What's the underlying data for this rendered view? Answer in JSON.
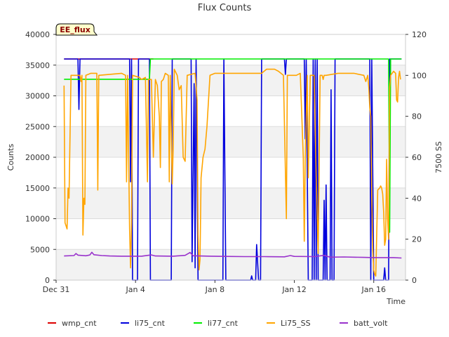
{
  "chart_data": {
    "type": "line",
    "title": "Flux Counts",
    "xlabel": "Time",
    "ylabel": "Counts",
    "ylabel_right": "7500 SS",
    "annotation": "EE_flux",
    "xlim": [
      0,
      17.6
    ],
    "ylim": [
      0,
      40000
    ],
    "ylim_right": [
      0,
      120
    ],
    "x_ticks": [
      {
        "x": 0,
        "label": "Dec 31"
      },
      {
        "x": 4,
        "label": "Jan 4"
      },
      {
        "x": 8,
        "label": "Jan 8"
      },
      {
        "x": 12,
        "label": "Jan 12"
      },
      {
        "x": 16,
        "label": "Jan 16"
      }
    ],
    "y_ticks": [
      0,
      5000,
      10000,
      15000,
      20000,
      25000,
      30000,
      35000,
      40000
    ],
    "y_ticks_right": [
      0,
      20,
      40,
      60,
      80,
      100,
      120
    ],
    "grid": true,
    "legend_position": "bottom",
    "series": [
      {
        "name": "wmp_cnt",
        "color": "#dd0000",
        "axis": "left",
        "points": [
          [
            0.4,
            36000
          ],
          [
            4.9,
            36000
          ]
        ]
      },
      {
        "name": "li75_cnt",
        "color": "#0000dd",
        "axis": "left",
        "points": [
          [
            0.4,
            36000
          ],
          [
            1.1,
            36000
          ],
          [
            1.15,
            27800
          ],
          [
            1.2,
            36000
          ],
          [
            3.7,
            36000
          ],
          [
            3.75,
            16000
          ],
          [
            3.8,
            36000
          ],
          [
            3.85,
            0
          ],
          [
            4.1,
            0
          ],
          [
            4.15,
            36000
          ],
          [
            4.7,
            36000
          ],
          [
            4.75,
            0
          ],
          [
            5.8,
            0
          ],
          [
            5.85,
            36000
          ],
          [
            6.8,
            36000
          ],
          [
            6.85,
            3000
          ],
          [
            6.95,
            32000
          ],
          [
            7.0,
            2000
          ],
          [
            7.05,
            36000
          ],
          [
            7.15,
            0
          ],
          [
            7.3,
            0
          ],
          [
            8.4,
            0
          ],
          [
            8.45,
            36000
          ],
          [
            8.55,
            0
          ],
          [
            9.8,
            0
          ],
          [
            9.85,
            700
          ],
          [
            9.9,
            0
          ],
          [
            10.05,
            0
          ],
          [
            10.1,
            5800
          ],
          [
            10.2,
            0
          ],
          [
            10.3,
            0
          ],
          [
            10.35,
            36000
          ],
          [
            11.5,
            36000
          ],
          [
            11.55,
            33500
          ],
          [
            11.6,
            36000
          ],
          [
            12.5,
            36000
          ],
          [
            12.55,
            23000
          ],
          [
            12.6,
            36000
          ],
          [
            12.7,
            0
          ],
          [
            12.9,
            0
          ],
          [
            12.95,
            36000
          ],
          [
            13.0,
            0
          ],
          [
            13.05,
            36000
          ],
          [
            13.1,
            0
          ],
          [
            13.15,
            36000
          ],
          [
            13.2,
            0
          ],
          [
            13.45,
            0
          ],
          [
            13.5,
            13000
          ],
          [
            13.55,
            0
          ],
          [
            13.6,
            15500
          ],
          [
            13.65,
            0
          ],
          [
            13.8,
            0
          ],
          [
            13.85,
            31000
          ],
          [
            13.9,
            0
          ],
          [
            14.0,
            0
          ],
          [
            14.05,
            36000
          ],
          [
            15.8,
            36000
          ],
          [
            15.85,
            0
          ],
          [
            15.9,
            36000
          ],
          [
            16.0,
            0
          ],
          [
            16.5,
            0
          ],
          [
            16.55,
            2000
          ],
          [
            16.6,
            0
          ],
          [
            16.75,
            0
          ],
          [
            16.8,
            36000
          ],
          [
            17.4,
            36000
          ]
        ]
      },
      {
        "name": "li77_cnt",
        "color": "#00ee00",
        "axis": "left",
        "points": [
          [
            0.4,
            32700
          ],
          [
            4.7,
            32700
          ],
          [
            4.75,
            36000
          ],
          [
            16.75,
            36000
          ],
          [
            16.8,
            7800
          ],
          [
            16.85,
            36000
          ],
          [
            17.4,
            36000
          ]
        ]
      },
      {
        "name": "Li75_SS",
        "color": "#ffa500",
        "axis": "right",
        "points": [
          [
            0.4,
            95
          ],
          [
            0.45,
            28
          ],
          [
            0.55,
            25
          ],
          [
            0.6,
            45
          ],
          [
            0.65,
            40
          ],
          [
            0.75,
            100
          ],
          [
            1.2,
            100
          ],
          [
            1.25,
            97
          ],
          [
            1.3,
            100
          ],
          [
            1.35,
            22
          ],
          [
            1.4,
            40
          ],
          [
            1.45,
            37
          ],
          [
            1.5,
            100
          ],
          [
            1.75,
            101
          ],
          [
            2.05,
            101
          ],
          [
            2.1,
            44
          ],
          [
            2.15,
            100
          ],
          [
            3.3,
            101
          ],
          [
            3.5,
            100
          ],
          [
            3.55,
            48
          ],
          [
            3.6,
            100
          ],
          [
            3.7,
            25
          ],
          [
            3.75,
            6
          ],
          [
            3.8,
            28
          ],
          [
            3.85,
            100
          ],
          [
            4.2,
            99
          ],
          [
            4.3,
            98
          ],
          [
            4.5,
            99
          ],
          [
            4.6,
            48
          ],
          [
            4.65,
            98
          ],
          [
            4.8,
            98
          ],
          [
            4.9,
            60
          ],
          [
            5.0,
            98
          ],
          [
            5.1,
            95
          ],
          [
            5.2,
            80
          ],
          [
            5.25,
            55
          ],
          [
            5.3,
            97
          ],
          [
            5.4,
            98
          ],
          [
            5.5,
            101
          ],
          [
            5.65,
            100
          ],
          [
            5.7,
            48
          ],
          [
            5.75,
            100
          ],
          [
            5.85,
            47
          ],
          [
            5.9,
            65
          ],
          [
            5.95,
            103
          ],
          [
            6.1,
            100
          ],
          [
            6.2,
            93
          ],
          [
            6.3,
            95
          ],
          [
            6.4,
            60
          ],
          [
            6.5,
            58
          ],
          [
            6.6,
            100
          ],
          [
            7.0,
            101
          ],
          [
            7.1,
            88
          ],
          [
            7.15,
            22
          ],
          [
            7.2,
            5
          ],
          [
            7.25,
            10
          ],
          [
            7.3,
            50
          ],
          [
            7.4,
            60
          ],
          [
            7.5,
            64
          ],
          [
            7.6,
            75
          ],
          [
            7.75,
            100
          ],
          [
            8.0,
            101
          ],
          [
            10.35,
            101
          ],
          [
            10.6,
            103
          ],
          [
            11.0,
            103
          ],
          [
            11.2,
            102
          ],
          [
            11.45,
            100
          ],
          [
            11.6,
            30
          ],
          [
            11.65,
            100
          ],
          [
            12.1,
            100
          ],
          [
            12.3,
            101
          ],
          [
            12.45,
            60
          ],
          [
            12.5,
            19
          ],
          [
            12.55,
            59
          ],
          [
            12.65,
            100
          ],
          [
            12.7,
            50
          ],
          [
            12.8,
            100
          ],
          [
            13.0,
            100
          ],
          [
            13.1,
            50
          ],
          [
            13.2,
            13
          ],
          [
            13.3,
            100
          ],
          [
            13.4,
            100
          ],
          [
            13.45,
            98
          ],
          [
            13.5,
            100
          ],
          [
            13.6,
            100
          ],
          [
            14.2,
            101
          ],
          [
            15.0,
            101
          ],
          [
            15.5,
            100
          ],
          [
            15.6,
            97
          ],
          [
            15.7,
            100
          ],
          [
            15.75,
            94
          ],
          [
            15.8,
            84
          ],
          [
            15.85,
            80
          ],
          [
            15.9,
            40
          ],
          [
            15.95,
            15
          ],
          [
            16.0,
            5
          ],
          [
            16.05,
            3
          ],
          [
            16.1,
            2
          ],
          [
            16.2,
            44
          ],
          [
            16.3,
            45
          ],
          [
            16.35,
            46
          ],
          [
            16.4,
            45
          ],
          [
            16.45,
            42
          ],
          [
            16.5,
            33
          ],
          [
            16.55,
            17
          ],
          [
            16.6,
            20
          ],
          [
            16.65,
            59
          ],
          [
            16.7,
            30
          ],
          [
            16.75,
            20
          ],
          [
            16.8,
            94
          ],
          [
            16.85,
            100
          ],
          [
            17.0,
            102
          ],
          [
            17.1,
            101
          ],
          [
            17.15,
            88
          ],
          [
            17.2,
            87
          ],
          [
            17.25,
            99
          ],
          [
            17.3,
            102
          ],
          [
            17.35,
            98
          ]
        ]
      },
      {
        "name": "batt_volt",
        "color": "#9932cc",
        "axis": "right",
        "points": [
          [
            0.4,
            11.8
          ],
          [
            0.9,
            12
          ],
          [
            1.0,
            13
          ],
          [
            1.1,
            12.2
          ],
          [
            1.5,
            11.9
          ],
          [
            1.7,
            12.3
          ],
          [
            1.8,
            13.6
          ],
          [
            1.9,
            12.4
          ],
          [
            2.3,
            12
          ],
          [
            2.7,
            11.8
          ],
          [
            3.3,
            11.7
          ],
          [
            3.8,
            11.7
          ],
          [
            4.3,
            11.7
          ],
          [
            4.8,
            12.3
          ],
          [
            5.0,
            11.8
          ],
          [
            5.9,
            11.7
          ],
          [
            6.5,
            12.1
          ],
          [
            6.75,
            13.5
          ],
          [
            6.9,
            11.9
          ],
          [
            7.8,
            11.7
          ],
          [
            8.5,
            11.6
          ],
          [
            9.5,
            11.5
          ],
          [
            10.5,
            11.5
          ],
          [
            11.5,
            11.4
          ],
          [
            11.8,
            12
          ],
          [
            12.0,
            11.6
          ],
          [
            13.0,
            11.5
          ],
          [
            13.5,
            12.1
          ],
          [
            13.8,
            11.2
          ],
          [
            14.5,
            11.3
          ],
          [
            15.5,
            11.1
          ],
          [
            16.0,
            11
          ],
          [
            17.0,
            11
          ],
          [
            17.4,
            10.8
          ]
        ]
      }
    ]
  }
}
